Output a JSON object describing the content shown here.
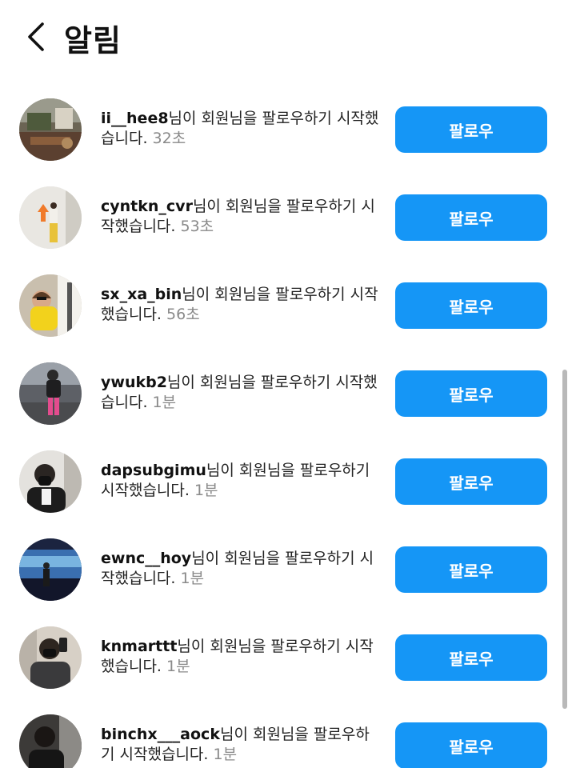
{
  "header": {
    "title": "알림",
    "back_icon": "chevron-left-icon"
  },
  "theme": {
    "button_color": "#1596f6",
    "time_color": "#8a8a8a"
  },
  "notifications": [
    {
      "username": "ii__hee8",
      "message": "님이 회원님을 팔로우하기 시작했습니다.",
      "time": "32초",
      "button": "팔로우"
    },
    {
      "username": "cyntkn_cvr",
      "message": "님이 회원님을 팔로우하기 시작했습니다.",
      "time": "53초",
      "button": "팔로우"
    },
    {
      "username": "sx_xa_bin",
      "message": "님이 회원님을 팔로우하기 시작했습니다.",
      "time": "56초",
      "button": "팔로우"
    },
    {
      "username": "ywukb2",
      "message": "님이 회원님을 팔로우하기 시작했습니다.",
      "time": "1분",
      "button": "팔로우"
    },
    {
      "username": "dapsubgimu",
      "message": "님이 회원님을 팔로우하기 시작했습니다.",
      "time": "1분",
      "button": "팔로우"
    },
    {
      "username": "ewnc__hoy",
      "message": "님이 회원님을 팔로우하기 시작했습니다.",
      "time": "1분",
      "button": "팔로우"
    },
    {
      "username": "knmarttt",
      "message": "님이 회원님을 팔로우하기 시작했습니다.",
      "time": "1분",
      "button": "팔로우"
    },
    {
      "username": "binchx___aock",
      "message": "님이 회원님을 팔로우하기 시작했습니다.",
      "time": "1분",
      "button": "팔로우"
    }
  ]
}
